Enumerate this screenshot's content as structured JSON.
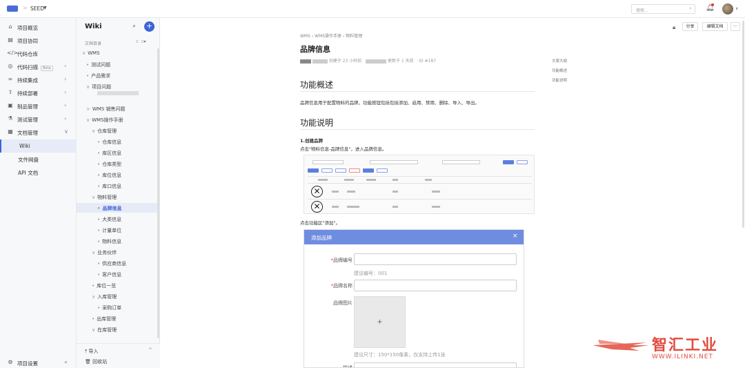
{
  "topbar": {
    "project": "SEED",
    "search_placeholder": "搜索..."
  },
  "leftnav": {
    "items": [
      {
        "label": "项目概览",
        "icon": "home-icon"
      },
      {
        "label": "项目协同",
        "icon": "board-icon"
      },
      {
        "label": "代码仓库",
        "icon": "code-icon"
      },
      {
        "label": "代码扫描",
        "icon": "scan-icon",
        "badge": "Beta"
      },
      {
        "label": "持续集成",
        "icon": "infinity-icon"
      },
      {
        "label": "持续部署",
        "icon": "rocket-icon"
      },
      {
        "label": "制品管理",
        "icon": "box-icon"
      },
      {
        "label": "测试管理",
        "icon": "flask-icon"
      },
      {
        "label": "文档管理",
        "icon": "doc-icon"
      }
    ],
    "sub_items": [
      "Wiki",
      "文件网盘",
      "API 文档"
    ],
    "footer": "项目设置"
  },
  "wiki": {
    "title": "Wiki",
    "dir_label": "文档目录",
    "tree": [
      {
        "label": "WMS",
        "level": 0,
        "prefix": "∨"
      },
      {
        "label": "测试问题",
        "level": 1,
        "prefix": "•"
      },
      {
        "label": "产品需求",
        "level": 1,
        "prefix": "•"
      },
      {
        "label": "项目问题",
        "level": 1,
        "prefix": "∨"
      },
      {
        "label": "WMS 销售问题",
        "level": 1,
        "prefix": ">"
      },
      {
        "label": "WMS操作手册",
        "level": 1,
        "prefix": "∨"
      },
      {
        "label": "仓库管理",
        "level": 2,
        "prefix": "∨"
      },
      {
        "label": "仓库信息",
        "level": 3,
        "prefix": "•"
      },
      {
        "label": "库区信息",
        "level": 3,
        "prefix": "•"
      },
      {
        "label": "仓库类型",
        "level": 3,
        "prefix": "•"
      },
      {
        "label": "库位信息",
        "level": 3,
        "prefix": "•"
      },
      {
        "label": "库口信息",
        "level": 3,
        "prefix": "•"
      },
      {
        "label": "物料管理",
        "level": 2,
        "prefix": "∨"
      },
      {
        "label": "品牌信息",
        "level": 3,
        "prefix": "•",
        "selected": true
      },
      {
        "label": "大类信息",
        "level": 3,
        "prefix": "•"
      },
      {
        "label": "计量单位",
        "level": 3,
        "prefix": "•"
      },
      {
        "label": "物料信息",
        "level": 3,
        "prefix": "•"
      },
      {
        "label": "业务伙伴",
        "level": 2,
        "prefix": "∨"
      },
      {
        "label": "供应商信息",
        "level": 3,
        "prefix": "•"
      },
      {
        "label": "客户信息",
        "level": 3,
        "prefix": "•"
      },
      {
        "label": "库位一览",
        "level": 2,
        "prefix": "•"
      },
      {
        "label": "入库管理",
        "level": 2,
        "prefix": "∨"
      },
      {
        "label": "采购订单",
        "level": 3,
        "prefix": "•"
      },
      {
        "label": "出库管理",
        "level": 2,
        "prefix": "•"
      },
      {
        "label": "在库管理",
        "level": 2,
        "prefix": "∨"
      }
    ],
    "footer": {
      "import": "导入",
      "recycle": "回收站"
    }
  },
  "doc": {
    "breadcrumb": "WMS › WMS操作手册 › 物料管理",
    "title": "品牌信息",
    "meta_created": "创建于 23 小时前",
    "meta_updated": "更新于 1 天前",
    "meta_id": "ID #187",
    "share_btn": "分享",
    "edit_btn": "编辑文档",
    "more_btn": "···",
    "section1": "功能概述",
    "section1_text": "品牌信息用于配置物料的品牌，功能按钮包括包括添加、启用、禁用、删除、导入、导出。",
    "section2": "功能说明",
    "step1_title": "1.创建品牌",
    "step1_text": "点击\"物料信息-品牌信息\"，进入品牌信息。",
    "step2_text": "点击功能区\"添加\"。",
    "toc": [
      "文章大纲",
      "功能概述",
      "功能说明"
    ]
  },
  "modal": {
    "title": "添加品牌",
    "close": "×",
    "field1_label": "品牌编号",
    "field1_hint": "建议编号：001",
    "field2_label": "品牌名称",
    "field3_label": "品牌图片",
    "upload_plus": "+",
    "upload_hint": "建议尺寸：150*150像素，仅支持上传1张",
    "field4_label": "描述"
  },
  "watermark": {
    "brand": "智汇工业",
    "url": "WWW.ILINKI.NET"
  },
  "colors": {
    "accent": "#3c64d6",
    "modal_header": "#6f8de0",
    "brand_red": "#e24b3e"
  }
}
